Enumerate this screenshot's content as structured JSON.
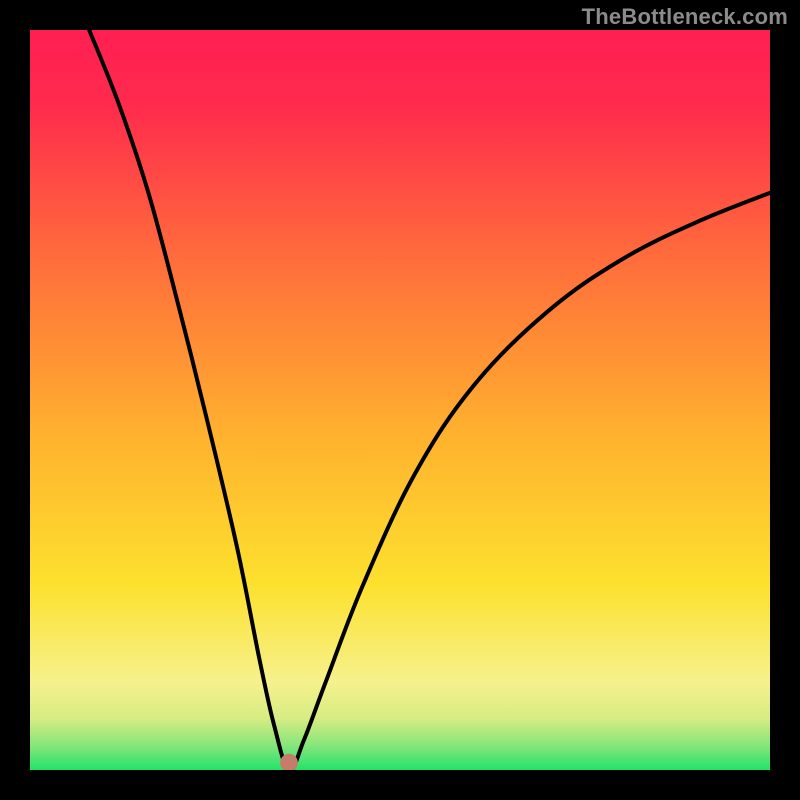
{
  "watermark": "TheBottleneck.com",
  "chart_data": {
    "type": "line",
    "title": "",
    "xlabel": "",
    "ylabel": "",
    "xlim": [
      0,
      100
    ],
    "ylim": [
      0,
      100
    ],
    "grid": false,
    "legend": false,
    "gradient_stops": [
      {
        "pos": 0.0,
        "color": "#22e36a"
      },
      {
        "pos": 0.03,
        "color": "#7ee57a"
      },
      {
        "pos": 0.07,
        "color": "#d8ec84"
      },
      {
        "pos": 0.12,
        "color": "#f6f18c"
      },
      {
        "pos": 0.25,
        "color": "#fde12e"
      },
      {
        "pos": 0.45,
        "color": "#ffb22e"
      },
      {
        "pos": 0.7,
        "color": "#ff6a3c"
      },
      {
        "pos": 0.9,
        "color": "#ff2a4d"
      },
      {
        "pos": 1.0,
        "color": "#ff1f53"
      }
    ],
    "curve": {
      "minimum_x": 35,
      "minimum_y": 0,
      "points": [
        {
          "x": 8,
          "y": 100
        },
        {
          "x": 12,
          "y": 90
        },
        {
          "x": 16,
          "y": 78
        },
        {
          "x": 20,
          "y": 63
        },
        {
          "x": 24,
          "y": 47
        },
        {
          "x": 28,
          "y": 30
        },
        {
          "x": 31,
          "y": 15
        },
        {
          "x": 33,
          "y": 6
        },
        {
          "x": 35,
          "y": 0
        },
        {
          "x": 37,
          "y": 4
        },
        {
          "x": 40,
          "y": 12
        },
        {
          "x": 45,
          "y": 25
        },
        {
          "x": 52,
          "y": 40
        },
        {
          "x": 60,
          "y": 52
        },
        {
          "x": 70,
          "y": 62
        },
        {
          "x": 80,
          "y": 69
        },
        {
          "x": 90,
          "y": 74
        },
        {
          "x": 100,
          "y": 78
        }
      ]
    },
    "marker": {
      "x": 35,
      "y": 1,
      "color": "#c77b6a",
      "radius_pct": 1.2
    }
  }
}
